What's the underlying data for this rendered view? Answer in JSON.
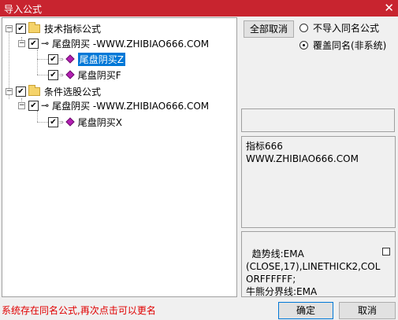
{
  "window": {
    "title": "导入公式",
    "close_glyph": "✕"
  },
  "tree": {
    "groups": [
      {
        "label": "技术指标公式",
        "checked": true,
        "children": [
          {
            "label": "尾盘阴买 -WWW.ZHIBIAO666.COM",
            "checked": true,
            "formulas": [
              {
                "label": "尾盘阴买Z",
                "checked": true,
                "selected": true
              },
              {
                "label": "尾盘阴买F",
                "checked": true,
                "selected": false
              }
            ]
          }
        ]
      },
      {
        "label": "条件选股公式",
        "checked": true,
        "children": [
          {
            "label": "尾盘阴买 -WWW.ZHIBIAO666.COM",
            "checked": true,
            "formulas": [
              {
                "label": "尾盘阴买X",
                "checked": true,
                "selected": false
              }
            ]
          }
        ]
      }
    ]
  },
  "options": {
    "cancel_all_label": "全部取消",
    "radio_no_import": "不导入同名公式",
    "radio_overwrite": "覆盖同名(非系统)",
    "selected_radio": "overwrite"
  },
  "info_panel": {
    "text": "指标666\nWWW.ZHIBIAO666.COM"
  },
  "code_panel": {
    "text": "趋势线:EMA\n(CLOSE,17),LINETHICK2,COL\nORFFFFFF;\n牛熊分界线:EMA"
  },
  "status_text": "系统存在同名公式,再次点击可以更名",
  "buttons": {
    "ok": "确定",
    "cancel": "取消"
  },
  "colors": {
    "titlebar": "#c8242f",
    "status_text": "#e00000",
    "selection": "#0078d7"
  }
}
